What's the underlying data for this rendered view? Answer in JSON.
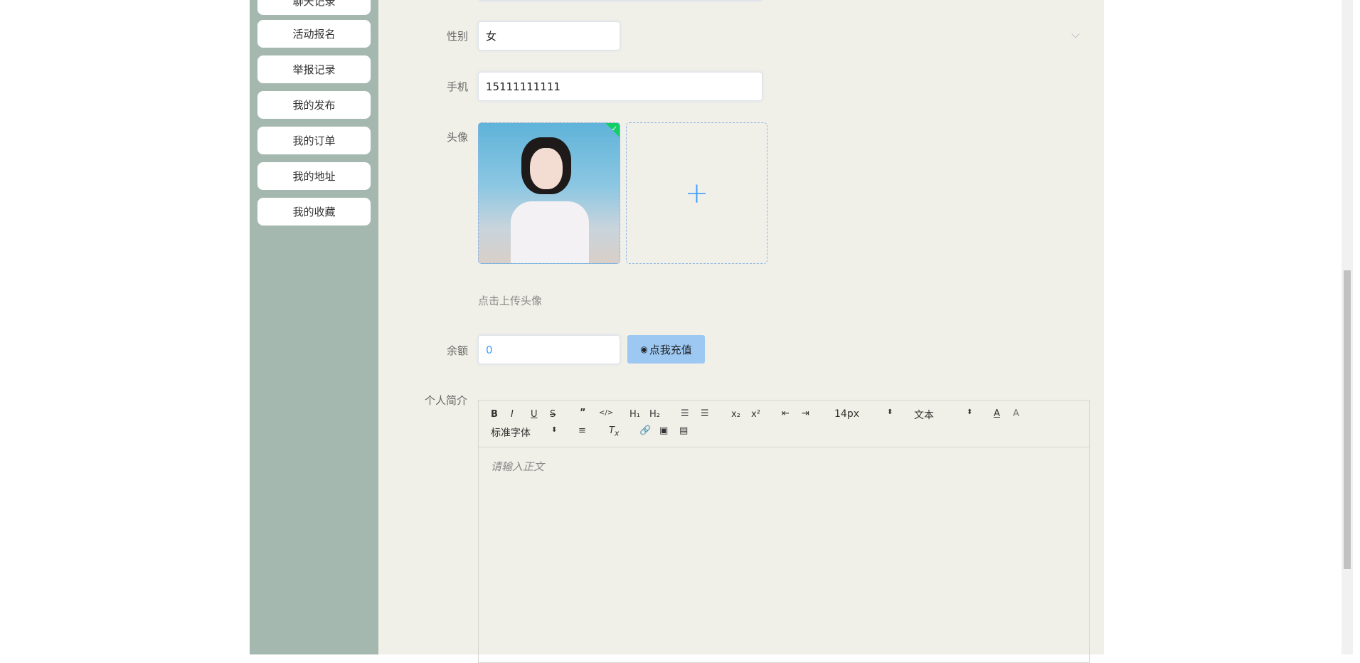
{
  "sidebar": {
    "items": [
      "聊天记录",
      "活动报名",
      "举报记录",
      "我的发布",
      "我的订单",
      "我的地址",
      "我的收藏"
    ]
  },
  "form": {
    "gender": {
      "label": "性别",
      "value": "女"
    },
    "phone": {
      "label": "手机",
      "value": "15111111111"
    },
    "avatar": {
      "label": "头像",
      "hint": "点击上传头像"
    },
    "balance": {
      "label": "余额",
      "value": "0",
      "recharge": "点我充值"
    },
    "intro": {
      "label": "个人简介",
      "placeholder": "请输入正文"
    }
  },
  "editor": {
    "font_size": "14px",
    "block": "文本",
    "font_family": "标准字体"
  },
  "colors": {
    "sidebar": "#a5b8b0",
    "main": "#f1f0e8",
    "accent": "#409eff"
  }
}
